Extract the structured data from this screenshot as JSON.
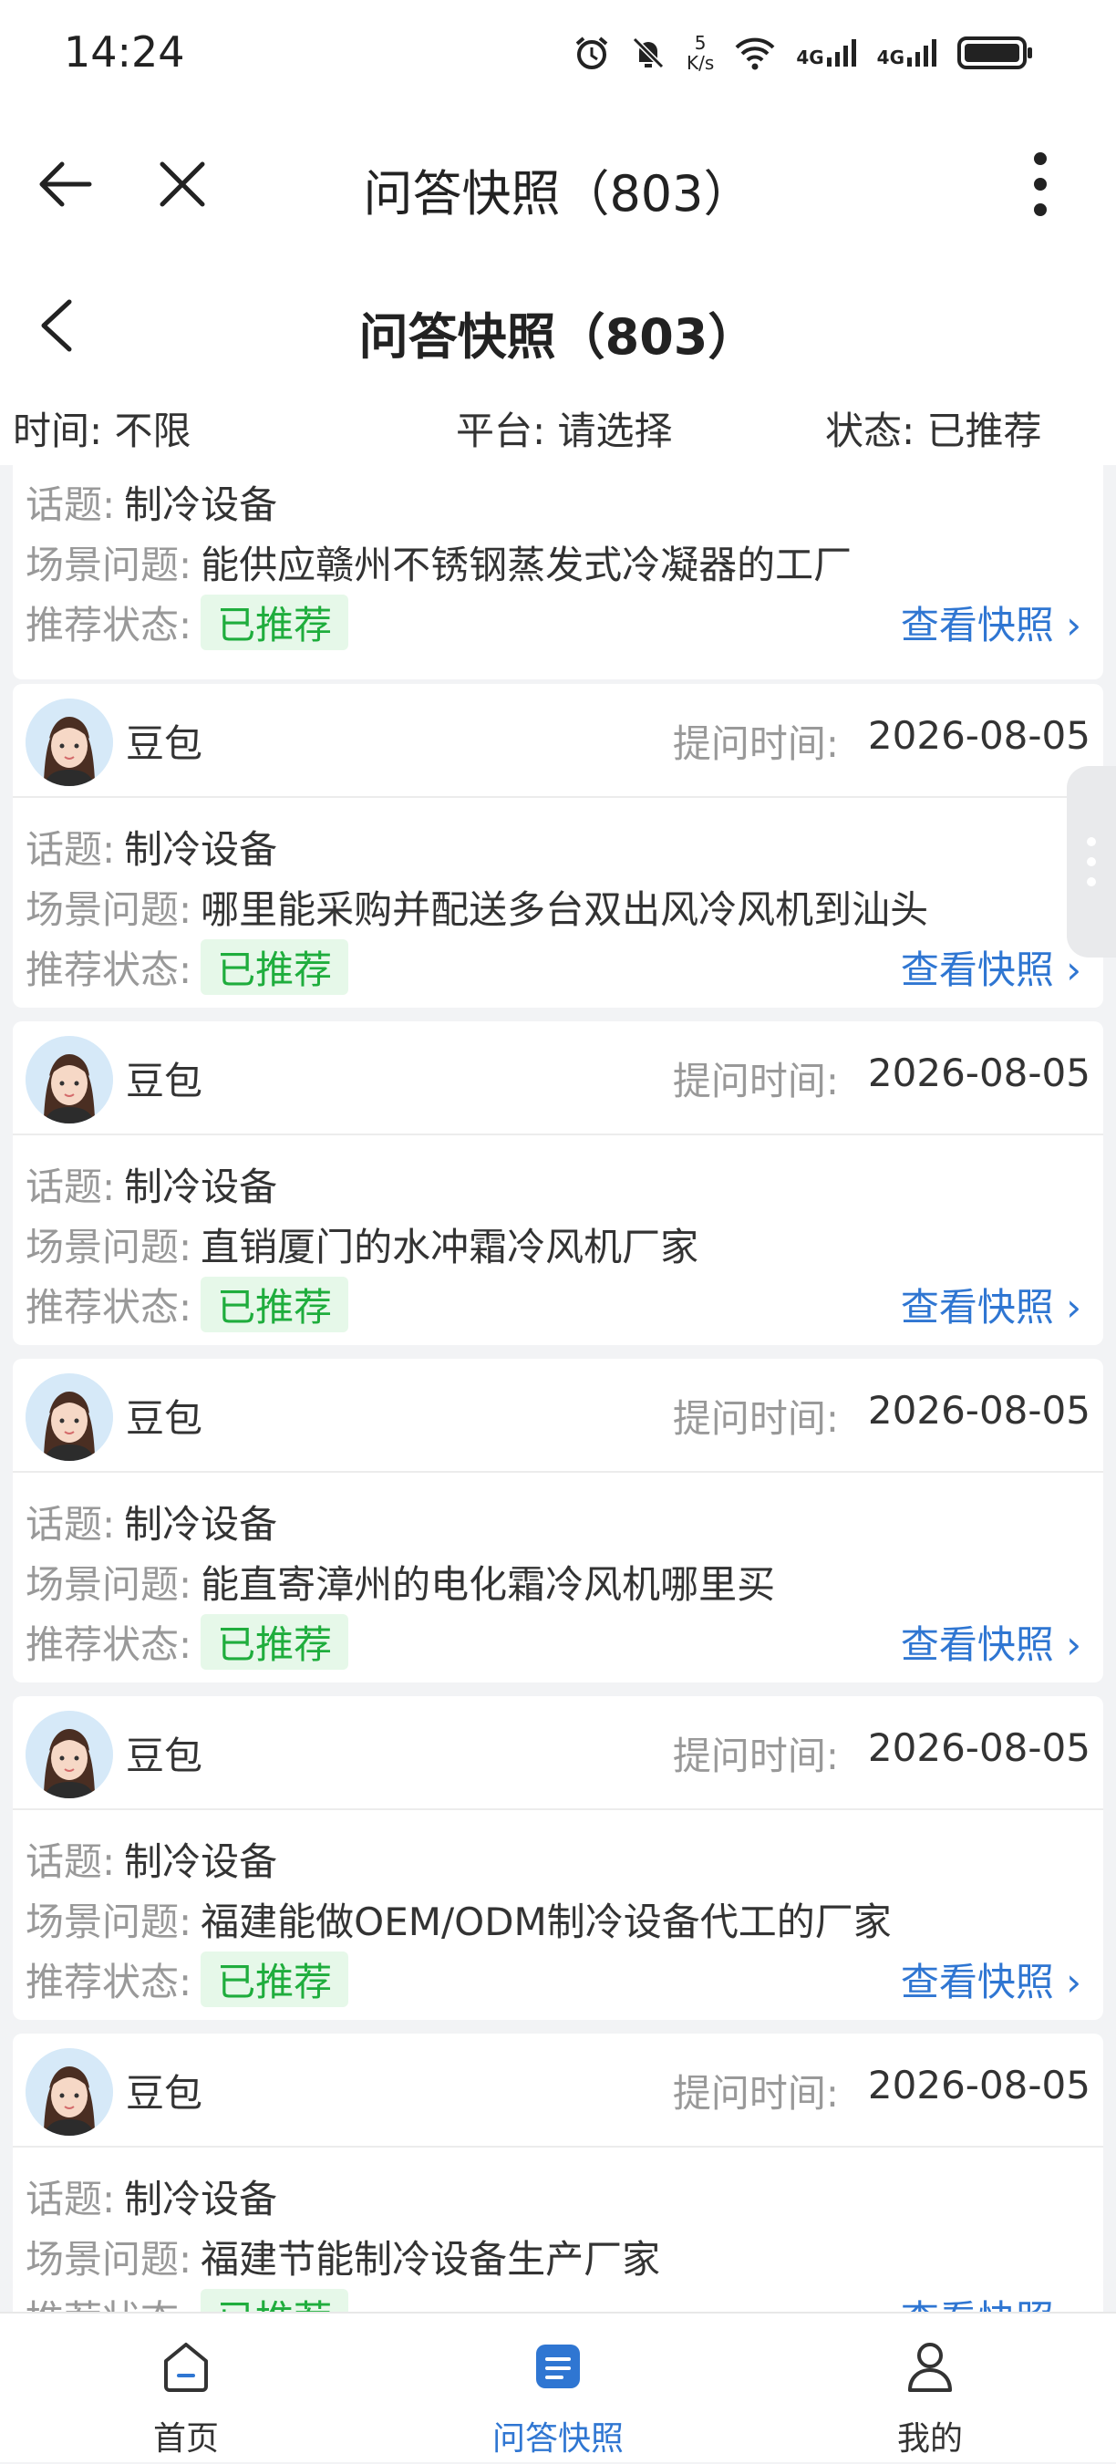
{
  "status_bar": {
    "time": "14:24",
    "speed_value": "5",
    "speed_unit": "K/s",
    "network_1": "4G",
    "network_2": "4G"
  },
  "browser_bar": {
    "title": "问答快照（803）"
  },
  "page_header": {
    "title": "问答快照（803）"
  },
  "filters": {
    "time_label": "时间:",
    "time_value": "不限",
    "platform_label": "平台:",
    "platform_value": "请选择",
    "status_label": "状态:",
    "status_value": "已推荐"
  },
  "labels": {
    "topic": "话题:",
    "scene": "场景问题:",
    "rec_status": "推荐状态:",
    "ask_time": "提问时间:",
    "view": "查看快照"
  },
  "partial_top_card": {
    "topic": "制冷设备",
    "scene": "能供应赣州不锈钢蒸发式冷凝器的工厂",
    "status": "已推荐"
  },
  "cards": [
    {
      "user": "豆包",
      "time": "2026-08-05",
      "topic": "制冷设备",
      "scene": "哪里能采购并配送多台双出风冷风机到汕头",
      "status": "已推荐"
    },
    {
      "user": "豆包",
      "time": "2026-08-05",
      "topic": "制冷设备",
      "scene": "直销厦门的水冲霜冷风机厂家",
      "status": "已推荐"
    },
    {
      "user": "豆包",
      "time": "2026-08-05",
      "topic": "制冷设备",
      "scene": "能直寄漳州的电化霜冷风机哪里买",
      "status": "已推荐"
    },
    {
      "user": "豆包",
      "time": "2026-08-05",
      "topic": "制冷设备",
      "scene": "福建能做OEM/ODM制冷设备代工的厂家",
      "status": "已推荐"
    },
    {
      "user": "豆包",
      "time": "2026-08-05",
      "topic": "制冷设备",
      "scene": "福建节能制冷设备生产厂家",
      "status": "已推荐"
    }
  ],
  "tab_bar": {
    "items": [
      {
        "label": "首页"
      },
      {
        "label": "问答快照"
      },
      {
        "label": "我的"
      }
    ],
    "active_color": "#2f76d2",
    "inactive_color": "#333333"
  }
}
